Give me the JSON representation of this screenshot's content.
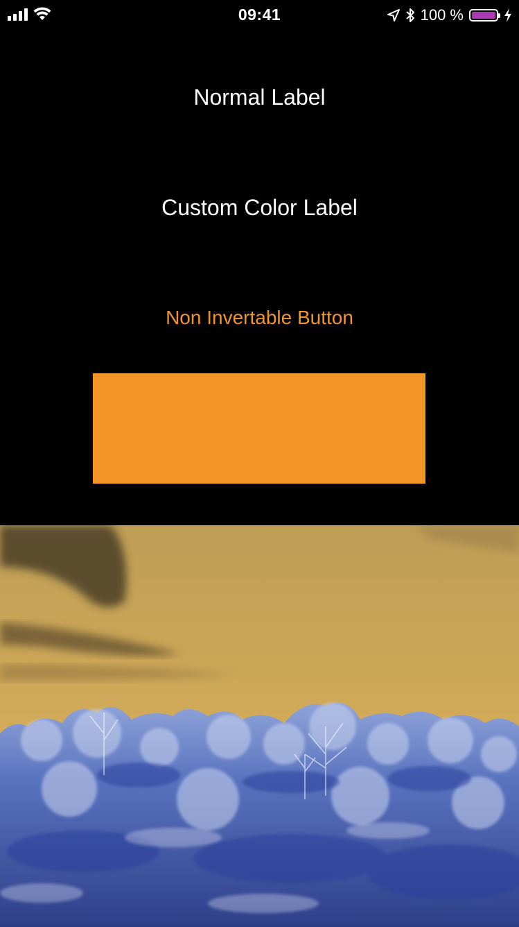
{
  "status_bar": {
    "time": "09:41",
    "battery_text": "100 %",
    "icons": [
      "cellular-signal-icon",
      "wifi-icon",
      "location-icon",
      "bluetooth-icon",
      "battery-icon",
      "charging-icon"
    ]
  },
  "labels": {
    "normal": "Normal Label",
    "custom_color": "Custom Color Label"
  },
  "button": {
    "label": "Non Invertable Button",
    "color": "#f39427"
  },
  "colors": {
    "background": "#000000",
    "accent_orange": "#f39427",
    "battery_fill": "#a93bb0"
  },
  "image": {
    "description_icon": "inverted-landscape-image"
  }
}
